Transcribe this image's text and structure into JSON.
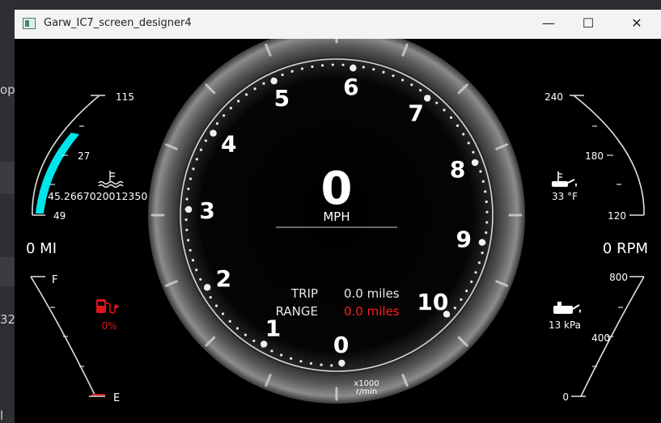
{
  "background": {
    "left_texts": [
      "op",
      "32",
      "l"
    ]
  },
  "window": {
    "title": "Garw_IC7_screen_designer4",
    "buttons": {
      "minimize": "—",
      "maximize": "☐",
      "close": "✕"
    }
  },
  "speedometer": {
    "speed": "0",
    "unit": "MPH"
  },
  "tachometer": {
    "labels": [
      "0",
      "1",
      "2",
      "3",
      "4",
      "5",
      "6",
      "7",
      "8",
      "9",
      "10"
    ],
    "unit_line1": "x1000",
    "unit_line2": "r/min",
    "rpm_fraction": 0
  },
  "trip": {
    "trip_label": "TRIP",
    "trip_value": "0.0 miles",
    "range_label": "RANGE",
    "range_value": "0.0 miles"
  },
  "left_top_gauge": {
    "ticks": [
      "115",
      "27",
      "49"
    ],
    "value_text": "45.2667020012350",
    "fill_level": 0.55,
    "fill_color": "#00e5ea"
  },
  "left_readout": "0 MI",
  "fuel_gauge": {
    "full_label": "F",
    "empty_label": "E",
    "percent": "0%",
    "warn_color": "#e0141a"
  },
  "right_top_gauge": {
    "ticks": [
      "240",
      "180",
      "120"
    ],
    "temp": "33 °F"
  },
  "right_readout": "0 RPM",
  "oil_gauge": {
    "ticks": [
      "800",
      "400",
      "0"
    ],
    "pressure": "13 kPa"
  },
  "colors": {
    "accent_red": "#ff1e1e",
    "cyan": "#00e5ea"
  },
  "icons": [
    "coolant-temp-icon",
    "oil-temp-icon",
    "oil-pressure-icon",
    "fuel-pump-icon"
  ]
}
